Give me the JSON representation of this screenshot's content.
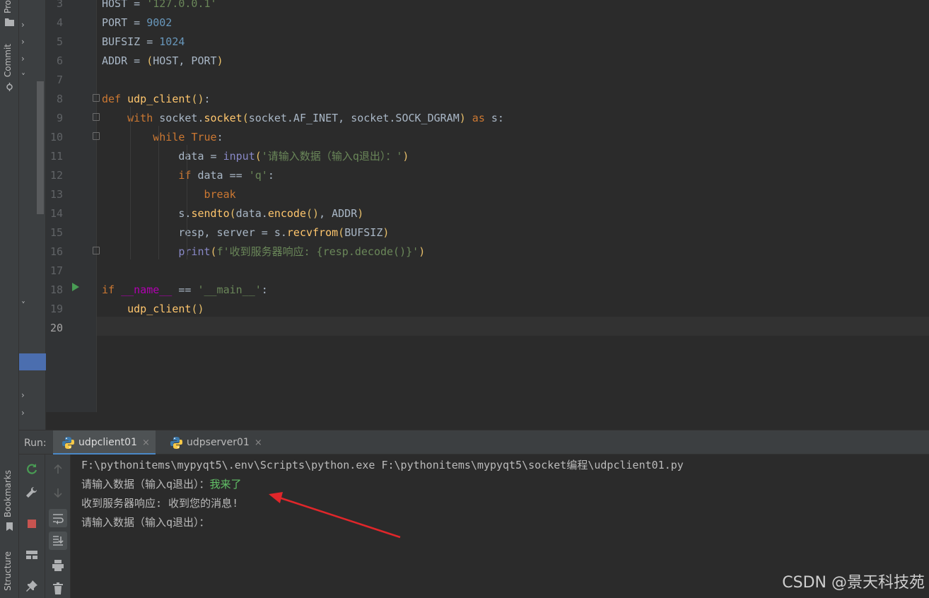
{
  "sidebar": {
    "project_tab": "Pro",
    "commit_tab": "Commit",
    "bookmarks_tab": "Bookmarks",
    "structure_tab": "Structure"
  },
  "editor": {
    "lines": [
      {
        "n": "3",
        "code": "HOST = '127.0.0.1'"
      },
      {
        "n": "4",
        "code": "PORT = 9002"
      },
      {
        "n": "5",
        "code": "BUFSIZ = 1024"
      },
      {
        "n": "6",
        "code": "ADDR = (HOST, PORT)"
      },
      {
        "n": "7",
        "code": ""
      },
      {
        "n": "8",
        "code": "def udp_client():"
      },
      {
        "n": "9",
        "code": "    with socket.socket(socket.AF_INET, socket.SOCK_DGRAM) as s:"
      },
      {
        "n": "10",
        "code": "        while True:"
      },
      {
        "n": "11",
        "code": "            data = input('请输入数据（输入q退出）：')"
      },
      {
        "n": "12",
        "code": "            if data == 'q':"
      },
      {
        "n": "13",
        "code": "                break"
      },
      {
        "n": "14",
        "code": "            s.sendto(data.encode(), ADDR)"
      },
      {
        "n": "15",
        "code": "            resp, server = s.recvfrom(BUFSIZ)"
      },
      {
        "n": "16",
        "code": "            print(f'收到服务器响应: {resp.decode()}')"
      },
      {
        "n": "17",
        "code": ""
      },
      {
        "n": "18",
        "code": "if __name__ == '__main__':"
      },
      {
        "n": "19",
        "code": "    udp_client()"
      },
      {
        "n": "20",
        "code": ""
      }
    ],
    "current_line": "20"
  },
  "run": {
    "label": "Run:",
    "tabs": [
      {
        "label": "udpclient01",
        "active": true
      },
      {
        "label": "udpserver01",
        "active": false
      }
    ],
    "close_glyph": "×",
    "console": {
      "command": "F:\\pythonitems\\mypyqt5\\.env\\Scripts\\python.exe F:\\pythonitems\\mypyqt5\\socket编程\\udpclient01.py",
      "prompt1": "请输入数据（输入q退出）：",
      "input1": "我来了",
      "response": "收到服务器响应: 收到您的消息!",
      "prompt2": "请输入数据（输入q退出）："
    }
  },
  "watermark": "CSDN @景天科技苑",
  "colors": {
    "accent_blue": "#4a88c7",
    "run_green": "#499c54",
    "stop_red": "#c75450",
    "annotation_red": "#e0262a"
  }
}
